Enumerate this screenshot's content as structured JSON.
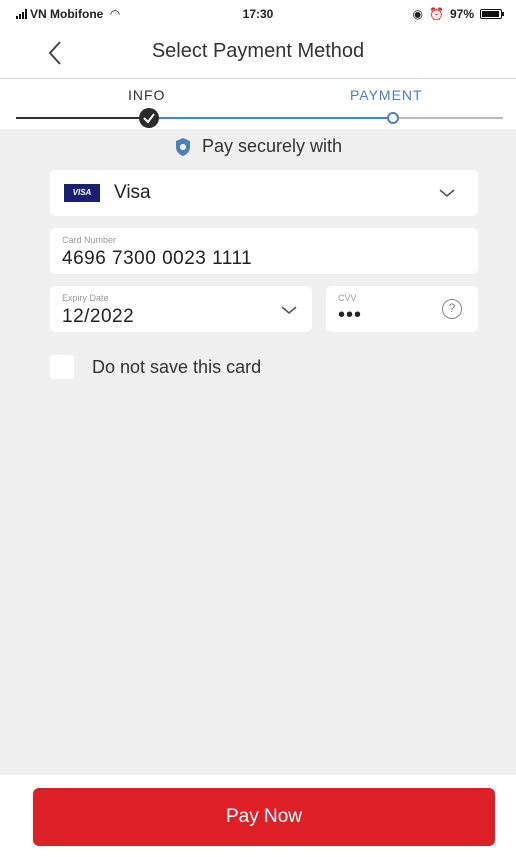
{
  "status_bar": {
    "carrier": "VN Mobifone",
    "time": "17:30",
    "battery": "97%"
  },
  "header": {
    "title": "Select Payment Method",
    "back_icon": "chevron-left-icon"
  },
  "stepper": {
    "steps": [
      {
        "label": "INFO",
        "state": "done"
      },
      {
        "label": "PAYMENT",
        "state": "current"
      }
    ]
  },
  "secure_note": {
    "text": "Pay securely with",
    "icon": "shield-icon"
  },
  "payment_form": {
    "card_brand": {
      "logo_text": "VISA",
      "selected": "Visa"
    },
    "card_number": {
      "label": "Card Number",
      "value": "4696 7300 0023 1111"
    },
    "expiry": {
      "label": "Expiry Date",
      "value": "12/2022"
    },
    "cvv": {
      "label": "CVV",
      "value": "•••",
      "help_symbol": "?"
    },
    "save_card": {
      "label": "Do not save this card",
      "checked": false
    }
  },
  "footer": {
    "pay_label": "Pay Now"
  },
  "colors": {
    "accent_red": "#dd1f26",
    "step_blue": "#4a7fc1",
    "visa_navy": "#1a1f71"
  }
}
